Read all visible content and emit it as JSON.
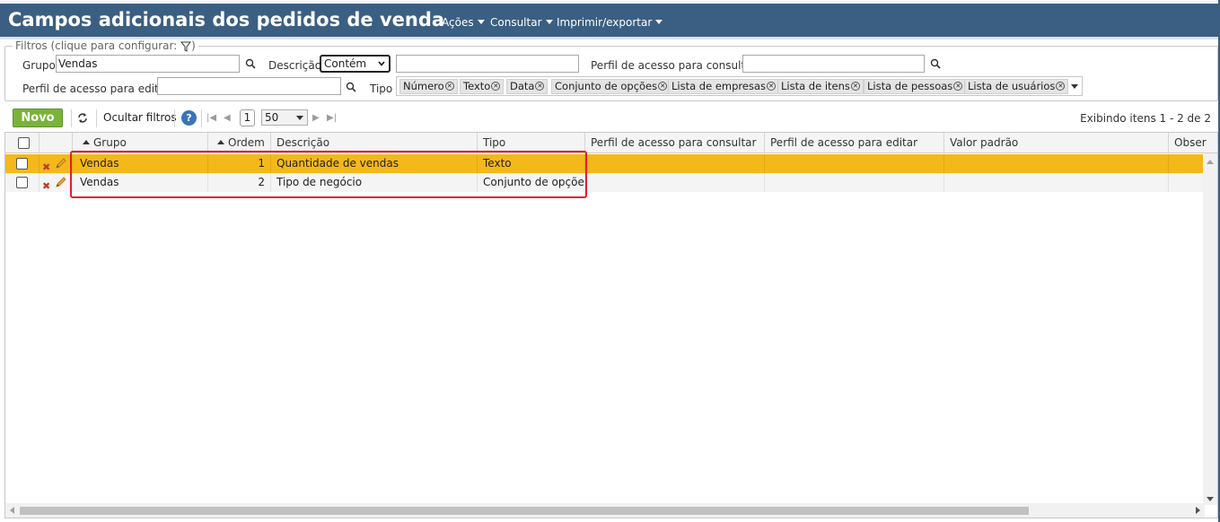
{
  "header": {
    "title": "Campos adicionais dos pedidos de venda",
    "menus": [
      "Ações",
      "Consultar",
      "Imprimir/exportar"
    ]
  },
  "filters": {
    "legend": "Filtros (clique para configurar:",
    "legend_close": ")",
    "grupo_label": "Grupo",
    "grupo_value": "Vendas",
    "descricao_label": "Descrição",
    "descricao_mode": "Contém",
    "descricao_value": "",
    "perfil_consultar_label": "Perfil de acesso para consultar",
    "perfil_consultar_value": "",
    "perfil_editar_label": "Perfil de acesso para editar",
    "perfil_editar_value": "",
    "tipo_label": "Tipo",
    "tipo_tags": [
      "Número",
      "Texto",
      "Data",
      "Conjunto de opções",
      "Lista de empresas",
      "Lista de itens",
      "Lista de pessoas",
      "Lista de usuários"
    ]
  },
  "toolbar": {
    "novo_label": "Novo",
    "ocultar_filtros_label": "Ocultar filtros",
    "help_label": "?",
    "page": "1",
    "page_size": "50",
    "showing": "Exibindo itens 1 - 2 de 2"
  },
  "grid": {
    "columns": [
      "Grupo",
      "Ordem",
      "Descrição",
      "Tipo",
      "Perfil de acesso para consultar",
      "Perfil de acesso para editar",
      "Valor padrão",
      "Obser"
    ],
    "rows": [
      {
        "grupo": "Vendas",
        "ordem": "1",
        "descricao": "Quantidade de vendas",
        "tipo": "Texto",
        "selected": true
      },
      {
        "grupo": "Vendas",
        "ordem": "2",
        "descricao": "Tipo de negócio",
        "tipo": "Conjunto de opções",
        "selected": false
      }
    ]
  },
  "colors": {
    "header_bg": "#3b5f82",
    "selected_row": "#f4b81a",
    "novo_button": "#7ab33a",
    "highlight_box": "#e0202a"
  },
  "icons": {
    "search": "magnifier-icon",
    "filter": "funnel-icon",
    "refresh": "refresh-icon",
    "delete": "delete-x-icon",
    "edit": "pencil-icon"
  }
}
